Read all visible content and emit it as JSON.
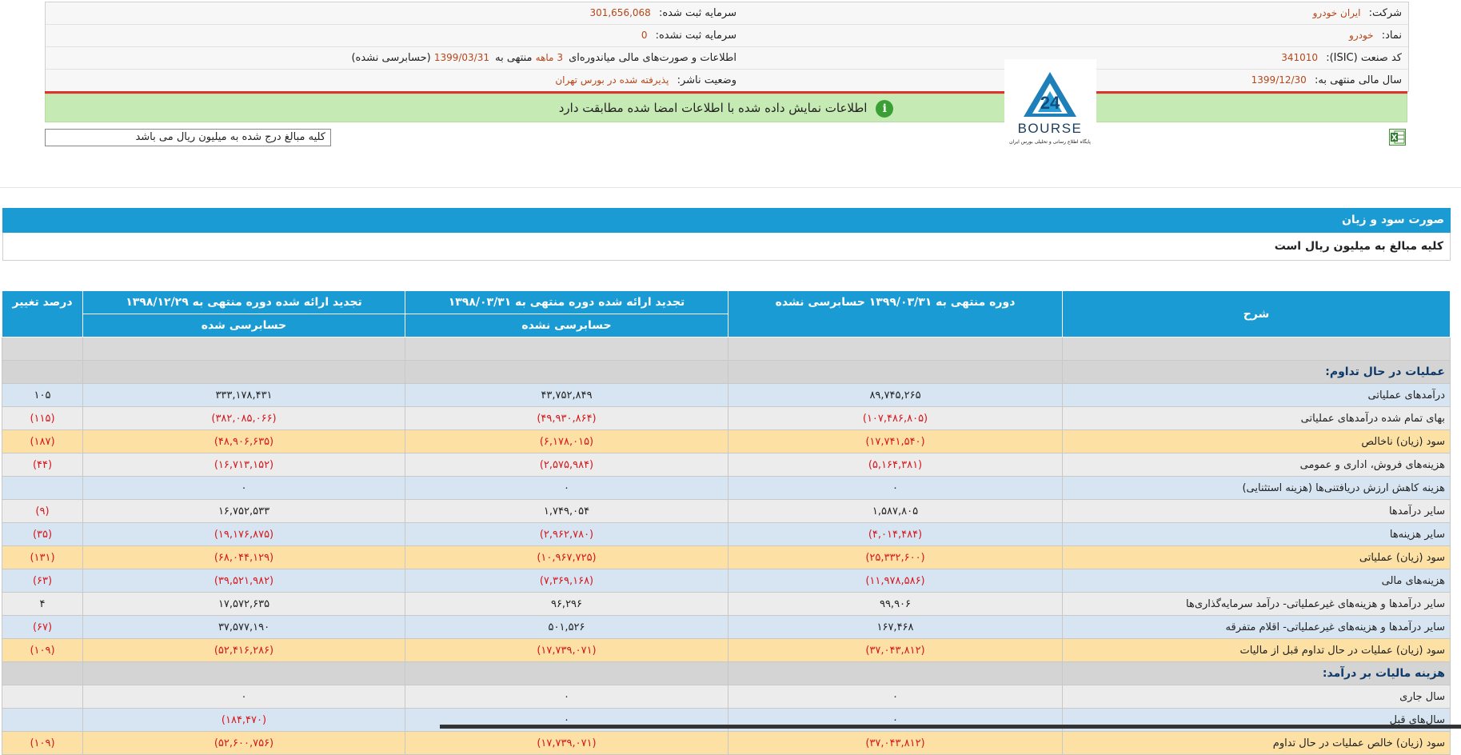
{
  "info": {
    "company_label": "شرکت:",
    "company_value": "ایران خودرو",
    "registered_capital_label": "سرمایه ثبت شده:",
    "registered_capital_value": "301,656,068",
    "symbol_label": "نماد:",
    "symbol_value": "خودرو",
    "unregistered_capital_label": "سرمایه ثبت نشده:",
    "unregistered_capital_value": "0",
    "isic_label": "کد صنعت (ISIC):",
    "isic_value": "341010",
    "report_prefix": "اطلاعات و صورت‌های مالی میاندوره‌ای",
    "report_period": "3 ماهه",
    "report_mid": "منتهی به",
    "report_date": "1399/03/31",
    "report_status": "(حسابرسی نشده)",
    "fiscal_year_label": "سال مالی منتهی به:",
    "fiscal_year_value": "1399/12/30",
    "publisher_status_label": "وضعیت ناشر:",
    "publisher_status_value": "پذیرفته شده در بورس تهران"
  },
  "notice": "اطلاعات نمایش داده شده با اطلاعات امضا شده مطابقت دارد",
  "logo": {
    "brand": "BOURSE",
    "tagline": "پایگاه اطلاع رسانی و تحلیلی بورس ایران",
    "mark": "24"
  },
  "amounts_note": "کلیه مبالغ درج شده به میلیون ریال می باشد",
  "section": {
    "title": "صورت سود و زیان",
    "subtitle": "کلیه مبالغ به میلیون ریال است"
  },
  "table": {
    "headers": {
      "desc": "شرح",
      "col1": "دوره منتهی به ۱۳۹۹/۰۳/۳۱ حسابرسی نشده",
      "col2_top": "تجدید ارائه شده دوره منتهی به ۱۳۹۸/۰۳/۳۱",
      "col2_bottom": "حسابرسی نشده",
      "col3_top": "تجدید ارائه شده دوره منتهی به ۱۳۹۸/۱۲/۲۹",
      "col3_bottom": "حسابرسی شده",
      "pct": "درصد تغییر"
    },
    "rows": [
      {
        "style": "gray",
        "desc": "",
        "c1": "",
        "c2": "",
        "c3": "",
        "pct": ""
      },
      {
        "style": "sect",
        "desc": "عملیات در حال تداوم:",
        "c1": "",
        "c2": "",
        "c3": "",
        "pct": ""
      },
      {
        "style": "blue",
        "desc": "درآمدهای عملیاتی",
        "c1": "۸۹,۷۴۵,۲۶۵",
        "c2": "۴۳,۷۵۲,۸۴۹",
        "c3": "۳۳۳,۱۷۸,۴۳۱",
        "pct": "۱۰۵"
      },
      {
        "style": "light",
        "desc": "بهای تمام شده درآمدهای عملیاتی",
        "c1": "(۱۰۷,۴۸۶,۸۰۵)",
        "c2": "(۴۹,۹۳۰,۸۶۴)",
        "c3": "(۳۸۲,۰۸۵,۰۶۶)",
        "pct": "(۱۱۵)"
      },
      {
        "style": "orange",
        "desc": "سود (زیان) ناخالص",
        "c1": "(۱۷,۷۴۱,۵۴۰)",
        "c2": "(۶,۱۷۸,۰۱۵)",
        "c3": "(۴۸,۹۰۶,۶۳۵)",
        "pct": "(۱۸۷)"
      },
      {
        "style": "light",
        "desc": "هزینه‌های فروش، اداری و عمومی",
        "c1": "(۵,۱۶۴,۳۸۱)",
        "c2": "(۲,۵۷۵,۹۸۴)",
        "c3": "(۱۶,۷۱۳,۱۵۲)",
        "pct": "(۴۴)"
      },
      {
        "style": "blue",
        "desc": "هزینه کاهش ارزش دریافتنی‌ها (هزینه استثنایی)",
        "c1": "۰",
        "c2": "۰",
        "c3": "۰",
        "pct": ""
      },
      {
        "style": "light",
        "desc": "سایر درآمدها",
        "c1": "۱,۵۸۷,۸۰۵",
        "c2": "۱,۷۴۹,۰۵۴",
        "c3": "۱۶,۷۵۲,۵۳۳",
        "pct": "(۹)"
      },
      {
        "style": "blue",
        "desc": "سایر هزینه‌ها",
        "c1": "(۴,۰۱۴,۴۸۴)",
        "c2": "(۲,۹۶۲,۷۸۰)",
        "c3": "(۱۹,۱۷۶,۸۷۵)",
        "pct": "(۳۵)"
      },
      {
        "style": "orange",
        "desc": "سود (زیان) عملیاتی",
        "c1": "(۲۵,۳۳۲,۶۰۰)",
        "c2": "(۱۰,۹۶۷,۷۲۵)",
        "c3": "(۶۸,۰۴۴,۱۲۹)",
        "pct": "(۱۳۱)"
      },
      {
        "style": "blue",
        "desc": "هزینه‌های مالی",
        "c1": "(۱۱,۹۷۸,۵۸۶)",
        "c2": "(۷,۳۶۹,۱۶۸)",
        "c3": "(۳۹,۵۲۱,۹۸۲)",
        "pct": "(۶۳)"
      },
      {
        "style": "light",
        "desc": "سایر درآمدها و هزینه‌های غیرعملیاتی- درآمد سرمایه‌گذاری‌ها",
        "c1": "۹۹,۹۰۶",
        "c2": "۹۶,۲۹۶",
        "c3": "۱۷,۵۷۲,۶۳۵",
        "pct": "۴"
      },
      {
        "style": "blue",
        "desc": "سایر درآمدها و هزینه‌های غیرعملیاتی- اقلام متفرقه",
        "c1": "۱۶۷,۴۶۸",
        "c2": "۵۰۱,۵۲۶",
        "c3": "۳۷,۵۷۷,۱۹۰",
        "pct": "(۶۷)"
      },
      {
        "style": "orange",
        "desc": "سود (زیان) عملیات در حال تداوم قبل از مالیات",
        "c1": "(۳۷,۰۴۳,۸۱۲)",
        "c2": "(۱۷,۷۳۹,۰۷۱)",
        "c3": "(۵۲,۴۱۶,۲۸۶)",
        "pct": "(۱۰۹)"
      },
      {
        "style": "sect",
        "desc": "هزینه مالیات بر درآمد:",
        "c1": "",
        "c2": "",
        "c3": "",
        "pct": ""
      },
      {
        "style": "light",
        "desc": "سال جاری",
        "c1": "۰",
        "c2": "۰",
        "c3": "۰",
        "pct": ""
      },
      {
        "style": "blue",
        "desc": "سال‌های قبل",
        "c1": "۰",
        "c2": "۰",
        "c3": "(۱۸۴,۴۷۰)",
        "pct": ""
      },
      {
        "style": "orange",
        "desc": "سود (زیان) خالص عملیات در حال تداوم",
        "c1": "(۳۷,۰۴۳,۸۱۲)",
        "c2": "(۱۷,۷۳۹,۰۷۱)",
        "c3": "(۵۲,۶۰۰,۷۵۶)",
        "pct": "(۱۰۹)"
      }
    ]
  },
  "colors": {
    "header_blue": "#1a9bd4",
    "negative_red": "#d6171b",
    "value_orange": "#b5471a",
    "notice_green": "#c6eab4"
  }
}
